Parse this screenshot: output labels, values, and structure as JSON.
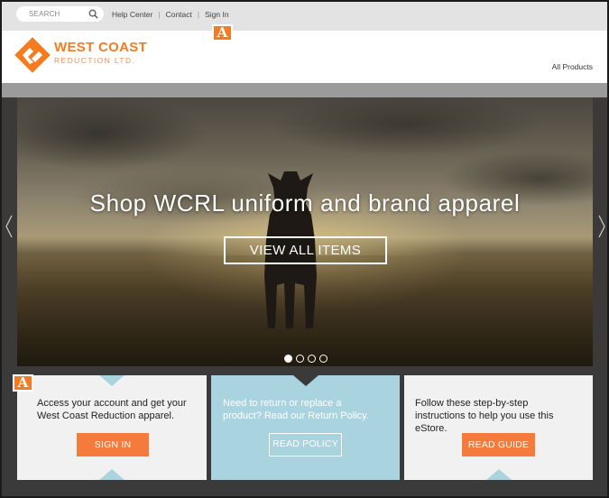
{
  "topbar": {
    "search_placeholder": "SEARCH",
    "links": [
      "Help Center",
      "Contact",
      "Sign In"
    ],
    "badge": "A"
  },
  "header": {
    "brand_name": "WEST COAST",
    "brand_sub": "REDUCTION LTD.",
    "all_products": "All Products"
  },
  "hero": {
    "title": "Shop WCRL uniform and brand apparel",
    "button": "VIEW ALL ITEMS",
    "slide_count": 4,
    "active_slide": 1
  },
  "panels": [
    {
      "text": "Access your account and get your West Coast Reduction apparel.",
      "button": "SIGN IN"
    },
    {
      "text": "Need to return or replace a product? Read our Return Policy.",
      "button": "READ POLICY"
    },
    {
      "text": "Follow these step-by-step instructions to help you use this eStore.",
      "button": "READ GUIDE"
    }
  ],
  "annotation_badge": "A",
  "colors": {
    "accent": "#f47b20",
    "button": "#f47b3c",
    "panel_blue": "#a9d3de",
    "panel_gray": "#f1f1f1",
    "topbar": "#e3e3e3"
  }
}
